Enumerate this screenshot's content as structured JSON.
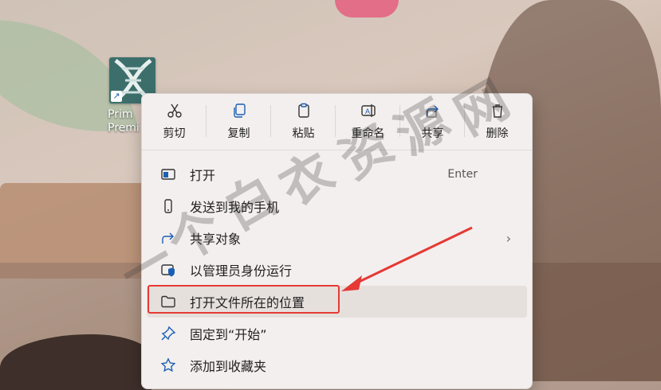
{
  "desktop_icon": {
    "label_line1": "Prim",
    "label_line2": "Premi"
  },
  "toolbar": [
    {
      "id": "cut",
      "label": "剪切",
      "icon": "scissors-icon"
    },
    {
      "id": "copy",
      "label": "复制",
      "icon": "copy-icon"
    },
    {
      "id": "paste",
      "label": "粘贴",
      "icon": "clipboard-icon"
    },
    {
      "id": "rename",
      "label": "重命名",
      "icon": "rename-icon"
    },
    {
      "id": "share",
      "label": "共享",
      "icon": "share-icon"
    },
    {
      "id": "delete",
      "label": "删除",
      "icon": "trash-icon"
    }
  ],
  "menu": {
    "items": [
      {
        "id": "open",
        "label": "打开",
        "hint": "Enter",
        "icon": "app-window-icon"
      },
      {
        "id": "send-to-phone",
        "label": "发送到我的手机",
        "icon": "phone-icon"
      },
      {
        "id": "share-object",
        "label": "共享对象",
        "icon": "share-icon",
        "submenu": "›"
      },
      {
        "id": "run-as-admin",
        "label": "以管理员身份运行",
        "icon": "shield-icon"
      },
      {
        "id": "open-file-location",
        "label": "打开文件所在的位置",
        "icon": "folder-icon"
      },
      {
        "id": "pin-to-start",
        "label": "固定到“开始”",
        "icon": "pin-icon"
      },
      {
        "id": "add-to-favorites",
        "label": "添加到收藏夹",
        "icon": "star-icon"
      }
    ]
  },
  "watermark": {
    "chars": [
      "一",
      "个",
      "白",
      "衣",
      "资",
      "源",
      "网"
    ]
  },
  "colors": {
    "accent": "#1a5fb4",
    "highlight": "#e53935"
  }
}
